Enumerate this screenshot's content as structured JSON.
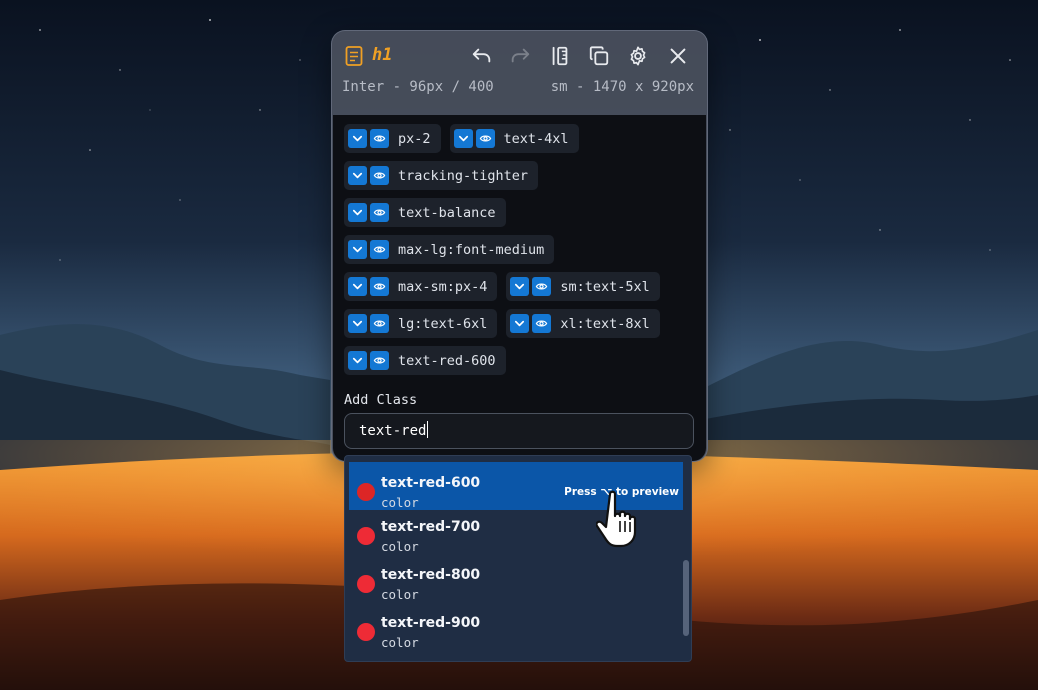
{
  "header": {
    "element_tag": "h1",
    "font_info": "Inter - 96px / 400",
    "viewport_info": "sm - 1470 x 920px",
    "icons": [
      "document-icon",
      "undo-icon",
      "redo-icon",
      "ruler-icon",
      "copy-icon",
      "gear-icon",
      "close-icon"
    ]
  },
  "classes": {
    "rows": [
      [
        "px-2",
        "text-4xl"
      ],
      [
        "tracking-tighter"
      ],
      [
        "text-balance"
      ],
      [
        "max-lg:font-medium"
      ],
      [
        "max-sm:px-4",
        "sm:text-5xl"
      ],
      [
        "lg:text-6xl",
        "xl:text-8xl"
      ],
      [
        "text-red-600"
      ]
    ]
  },
  "add_class": {
    "label": "Add Class",
    "value": "text-red"
  },
  "suggestions": [
    {
      "name": "text-red-600",
      "kind": "color",
      "color": "#dc2626",
      "hint": "Press ⌥ to preview",
      "selected": true
    },
    {
      "name": "text-red-700",
      "kind": "color",
      "color": "#ee2b36"
    },
    {
      "name": "text-red-800",
      "kind": "color",
      "color": "#ee2b36"
    },
    {
      "name": "text-red-900",
      "kind": "color",
      "color": "#ee2b36"
    }
  ],
  "colors": {
    "accent": "#1478d4",
    "selected_option": "#0b56a8",
    "tag": "#f0a024"
  }
}
